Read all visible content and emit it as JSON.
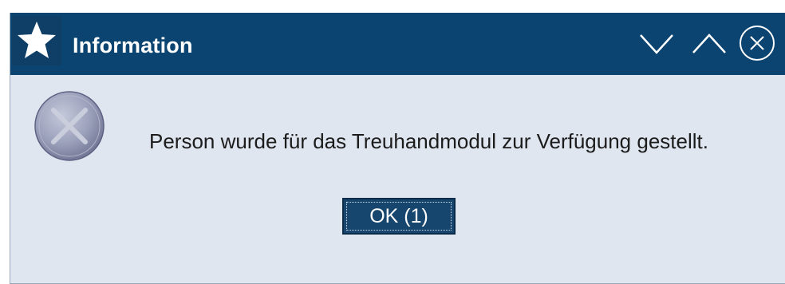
{
  "window": {
    "title": "Information",
    "app_icon": "star-icon",
    "controls": {
      "minimize_icon": "chevron-down-icon",
      "maximize_icon": "chevron-up-icon",
      "close_icon": "circle-x-icon"
    }
  },
  "dialog": {
    "status_icon": "error-circle-x-icon",
    "message": "Person wurde für das Treuhandmodul zur Verfügung gestellt.",
    "ok_label": "OK (1)"
  },
  "colors": {
    "titlebar": "#0b4470",
    "body": "#dfe6ef",
    "button": "#16466d"
  }
}
